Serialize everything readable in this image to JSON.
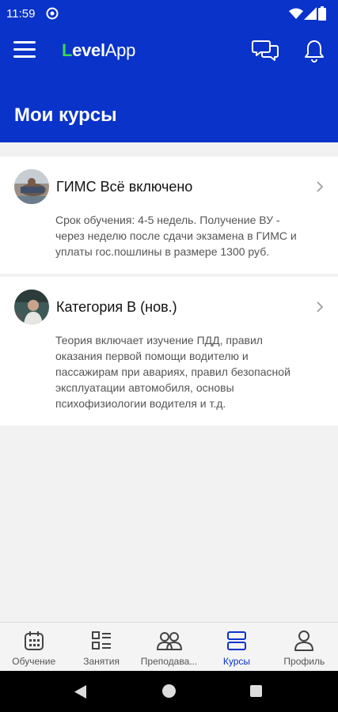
{
  "status_bar": {
    "time": "11:59"
  },
  "app_bar": {
    "logo_first_letter": "L",
    "logo_middle": "evel",
    "logo_rest": "App",
    "page_title": "Мои курсы"
  },
  "courses": [
    {
      "title": "ГИМС Всё включено",
      "description": "Срок обучения: 4-5 недель. Получение ВУ - через неделю после сдачи экзамена в ГИМС и уплаты гос.пошлины в размере 1300 руб."
    },
    {
      "title": "Категория В (нов.)",
      "description": "Теория включает изучение ПДД, правил оказания первой помощи водителю и пассажирам при авариях, правил безопасной эксплуатации автомобиля, основы психофизиологии водителя и т.д."
    }
  ],
  "bottom_nav": {
    "items": [
      {
        "label": "Обучение",
        "icon": "calendar-icon"
      },
      {
        "label": "Занятия",
        "icon": "schedule-list-icon"
      },
      {
        "label": "Преподава...",
        "icon": "people-icon"
      },
      {
        "label": "Курсы",
        "icon": "courses-icon"
      },
      {
        "label": "Профиль",
        "icon": "profile-icon"
      }
    ],
    "active_label": "Курсы"
  },
  "colors": {
    "brand_blue": "#0a33c9",
    "logo_green": "#39d84f",
    "background": "#f2f2f2"
  }
}
